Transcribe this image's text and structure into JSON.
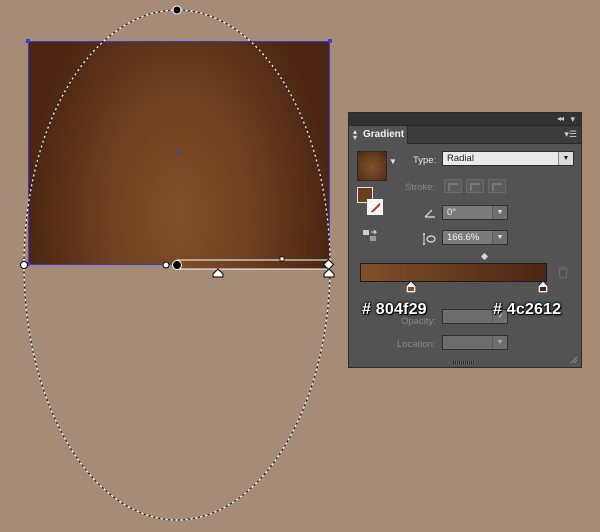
{
  "canvas": {
    "background": "#a68b77",
    "gradient_start_color": "#804f29",
    "gradient_end_color": "#4c2612"
  },
  "panel": {
    "tab_title": "Gradient",
    "collapse_icon": "double-chevron-left-icon",
    "close_icon": "close-icon",
    "menu_icon": "panel-menu-icon",
    "type_label": "Type:",
    "type_value": "Radial",
    "stroke_label": "Stroke:",
    "angle_value": "0°",
    "aspect_value": "166.6%",
    "opacity_label": "Opacity:",
    "opacity_value": "",
    "location_label": "Location:",
    "location_value": ""
  },
  "annotations": {
    "left_color": "# 804f29",
    "right_color": "# 4c2612"
  }
}
